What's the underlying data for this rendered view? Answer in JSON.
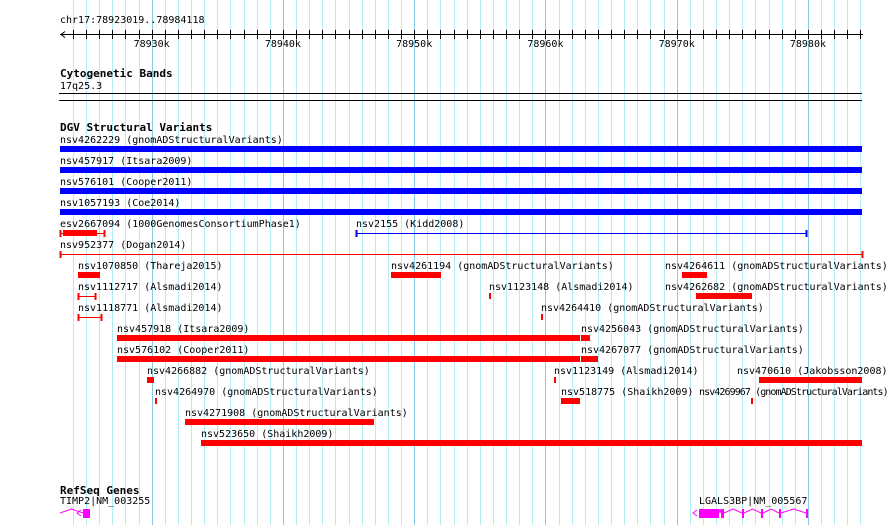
{
  "view": {
    "chrom": "chr17",
    "start": 78923019,
    "end": 78984118,
    "label": "chr17:78923019..78984118"
  },
  "ruler": {
    "ticks": [
      {
        "pos": 78930000,
        "label": "78930k"
      },
      {
        "pos": 78940000,
        "label": "78940k"
      },
      {
        "pos": 78950000,
        "label": "78950k"
      },
      {
        "pos": 78960000,
        "label": "78960k"
      },
      {
        "pos": 78970000,
        "label": "78970k"
      },
      {
        "pos": 78980000,
        "label": "78980k"
      }
    ]
  },
  "colors": {
    "blue": "#0000ff",
    "red": "#ff0000",
    "magenta": "#ff00ff",
    "grid_minor": "#b4ecf4",
    "grid_major": "#88c8e8"
  },
  "cytobands": {
    "title": "Cytogenetic Bands",
    "band": "17q25.3"
  },
  "dgv": {
    "title": "DGV Structural Variants",
    "features": [
      {
        "label": "nsv4262229 (gnomADStructuralVariants)",
        "row": 0,
        "start": 78923019,
        "end": 78984118,
        "color": "blue",
        "style": "thick"
      },
      {
        "label": "nsv457917 (Itsara2009)",
        "row": 1,
        "start": 78923019,
        "end": 78984118,
        "color": "blue",
        "style": "thick"
      },
      {
        "label": "nsv576101 (Cooper2011)",
        "row": 2,
        "start": 78923019,
        "end": 78984118,
        "color": "blue",
        "style": "thick"
      },
      {
        "label": "nsv1057193 (Coe2014)",
        "row": 3,
        "start": 78923019,
        "end": 78984118,
        "color": "blue",
        "style": "thick"
      },
      {
        "label": "esv2667094 (1000GenomesConsortiumPhase1)",
        "row": 4,
        "start": 78923019,
        "end": 78926371,
        "thickStart": 78923248,
        "thickEnd": 78925838,
        "color": "red",
        "style": "mixed"
      },
      {
        "label": "nsv2155 (Kidd2008)",
        "row": 4,
        "start": 78945568,
        "end": 78979849,
        "color": "blue",
        "style": "thin"
      },
      {
        "label": "nsv952377 (Dogan2014)",
        "row": 5,
        "start": 78923019,
        "end": 78984118,
        "color": "red",
        "style": "thin"
      },
      {
        "label": "nsv1070850 (Thareja2015)",
        "row": 6,
        "start": 78924390,
        "end": 78926066,
        "color": "red",
        "style": "thick"
      },
      {
        "label": "nsv4261194 (gnomADStructuralVariants)",
        "row": 6,
        "start": 78948235,
        "end": 78952044,
        "color": "red",
        "style": "thick"
      },
      {
        "label": "nsv4264611 (gnomADStructuralVariants)",
        "row": 6,
        "start": 78970403,
        "end": 78972307,
        "color": "red",
        "style": "thick"
      },
      {
        "label": "nsv1112717 (Alsmadi2014)",
        "row": 7,
        "start": 78924390,
        "end": 78925685,
        "color": "red",
        "style": "thin"
      },
      {
        "label": "nsv1123148 (Alsmadi2014)",
        "row": 7,
        "start": 78955680,
        "end": 78955780,
        "color": "red",
        "style": "thick"
      },
      {
        "label": "nsv4262682 (gnomADStructuralVariants)",
        "row": 7,
        "start": 78971470,
        "end": 78975736,
        "color": "red",
        "style": "thick"
      },
      {
        "label": "nsv1118771 (Alsmadi2014)",
        "row": 8,
        "start": 78924390,
        "end": 78926142,
        "color": "red",
        "style": "thin"
      },
      {
        "label": "nsv4264410 (gnomADStructuralVariants)",
        "row": 8,
        "start": 78959700,
        "end": 78959820,
        "color": "red",
        "style": "thick"
      },
      {
        "label": "nsv457918 (Itsara2009)",
        "row": 9,
        "start": 78927361,
        "end": 78962633,
        "color": "red",
        "style": "thick"
      },
      {
        "label": "nsv4256043 (gnomADStructuralVariants)",
        "row": 9,
        "start": 78962709,
        "end": 78963400,
        "color": "red",
        "style": "thick"
      },
      {
        "label": "nsv576102 (Cooper2011)",
        "row": 10,
        "start": 78927361,
        "end": 78962633,
        "color": "red",
        "style": "thick"
      },
      {
        "label": "nsv4267077 (gnomADStructuralVariants)",
        "row": 10,
        "start": 78962709,
        "end": 78964004,
        "color": "red",
        "style": "thick"
      },
      {
        "label": "nsv4266882 (gnomADStructuralVariants)",
        "row": 11,
        "start": 78929647,
        "end": 78930180,
        "color": "red",
        "style": "thick"
      },
      {
        "label": "nsv1123149 (Alsmadi2014)",
        "row": 11,
        "start": 78960620,
        "end": 78960740,
        "color": "red",
        "style": "thick"
      },
      {
        "label": "nsv470610 (Jakobsson2008)",
        "row": 11,
        "start": 78976301,
        "end": 78984118,
        "color": "red",
        "style": "thick"
      },
      {
        "label": "nsv4264970 (gnomADStructuralVariants)",
        "row": 12,
        "start": 78930220,
        "end": 78930340,
        "color": "red",
        "style": "thick"
      },
      {
        "label": "nsv518775 (Shaikh2009)",
        "row": 12,
        "start": 78961185,
        "end": 78962633,
        "color": "red",
        "style": "thick"
      },
      {
        "label": "nsv4269967 (gnomADStructuralVariants)",
        "row": 12,
        "start": 78975630,
        "end": 78975750,
        "color": "red",
        "style": "thick"
      },
      {
        "label": "nsv4271908 (gnomADStructuralVariants)",
        "row": 13,
        "start": 78932542,
        "end": 78946940,
        "color": "red",
        "style": "thick"
      },
      {
        "label": "nsv523650 (Shaikh2009)",
        "row": 14,
        "start": 78933761,
        "end": 78984118,
        "color": "red",
        "style": "thick"
      }
    ]
  },
  "refseq": {
    "title": "RefSeq Genes",
    "genes": [
      {
        "label": "TIMP2|NM_003255",
        "start": 78923019,
        "end": 78925300,
        "strand": "-",
        "exons": [
          [
            78924800,
            78925300
          ]
        ]
      },
      {
        "label": "LGALS3BP|NM_005567",
        "start": 78971700,
        "end": 78980000,
        "strand": "-",
        "exons": [
          [
            78971700,
            78973220
          ],
          [
            78973370,
            78973600
          ],
          [
            78974950,
            78975030
          ],
          [
            78976450,
            78976530
          ],
          [
            78977800,
            78977880
          ],
          [
            78979850,
            78980000
          ]
        ]
      }
    ]
  }
}
